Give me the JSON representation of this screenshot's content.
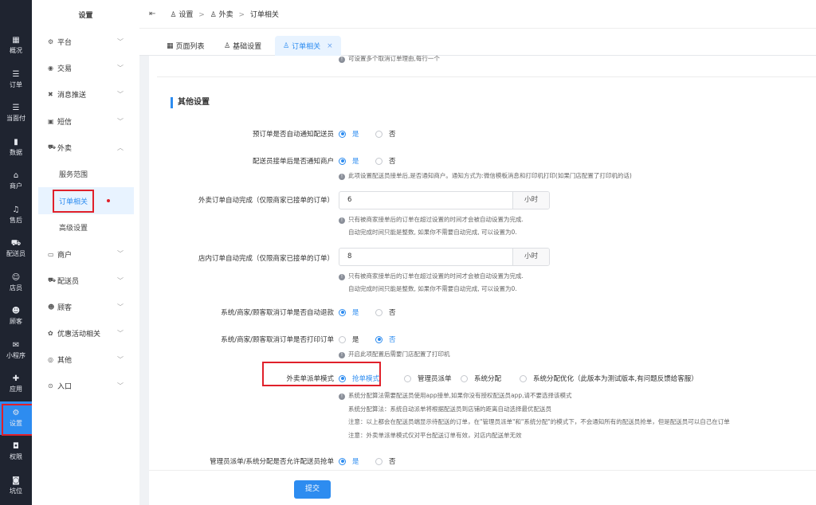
{
  "rail": [
    {
      "icon": "grid-icon",
      "glyph": "▦",
      "label": "概况"
    },
    {
      "icon": "list-icon",
      "glyph": "☰",
      "label": "订单"
    },
    {
      "icon": "list-icon",
      "glyph": "☰",
      "label": "当面付"
    },
    {
      "icon": "bar-chart-icon",
      "glyph": "▮",
      "label": "数据"
    },
    {
      "icon": "store-icon",
      "glyph": "⌂",
      "label": "商户"
    },
    {
      "icon": "headset-icon",
      "glyph": "♫",
      "label": "售后"
    },
    {
      "icon": "delivery-icon",
      "glyph": "⛟",
      "label": "配送员"
    },
    {
      "icon": "user-icon",
      "glyph": "☺",
      "label": "店员"
    },
    {
      "icon": "customer-icon",
      "glyph": "☻",
      "label": "顾客"
    },
    {
      "icon": "chat-icon",
      "glyph": "✉",
      "label": "小程序"
    },
    {
      "icon": "apps-icon",
      "glyph": "✚",
      "label": "应用"
    },
    {
      "icon": "gear-icon",
      "glyph": "⚙",
      "label": "设置"
    },
    {
      "icon": "lock-icon",
      "glyph": "◘",
      "label": "权限"
    },
    {
      "icon": "bookmark-icon",
      "glyph": "◙",
      "label": "坑位"
    }
  ],
  "sidebar": {
    "title": "设置",
    "items_top": [
      {
        "glyph": "⚙",
        "label": "平台",
        "icon": "gear-icon"
      },
      {
        "glyph": "◉",
        "label": "交易",
        "icon": "trade-icon"
      },
      {
        "glyph": "✖",
        "label": "消息推送",
        "icon": "message-icon"
      },
      {
        "glyph": "▣",
        "label": "短信",
        "icon": "sms-icon"
      },
      {
        "glyph": "⛟",
        "label": "外卖",
        "icon": "takeaway-icon"
      }
    ],
    "subitems": [
      "服务范围",
      "订单相关",
      "高级设置"
    ],
    "items_bottom": [
      {
        "glyph": "▭",
        "label": "商户",
        "icon": "store-icon"
      },
      {
        "glyph": "⛟",
        "label": "配送员",
        "icon": "delivery-icon"
      },
      {
        "glyph": "☻",
        "label": "顾客",
        "icon": "customer-icon"
      },
      {
        "glyph": "✿",
        "label": "优惠活动相关",
        "icon": "promo-icon"
      },
      {
        "glyph": "◎",
        "label": "其他",
        "icon": "other-icon"
      },
      {
        "glyph": "⊙",
        "label": "入口",
        "icon": "entry-icon"
      }
    ]
  },
  "breadcrumb": {
    "collapse": "⇤",
    "part1": "设置",
    "part2": "外卖",
    "part3": "订单相关"
  },
  "tabs": [
    {
      "label": "页面列表"
    },
    {
      "label": "基础设置"
    },
    {
      "label": "订单相关",
      "close": "×"
    }
  ],
  "form": {
    "top_help": "可设置多个取消订单理由,每行一个",
    "section_title": "其他设置",
    "yes": "是",
    "no": "否",
    "pre_order_label": "预订单是否自动通知配送员",
    "rider_accept_label": "配送员接单后是否通知商户",
    "rider_accept_help": "此项设置配送员接单后,是否通知商户。通知方式为:微信模板消息和打印机打印(如果门店配置了打印机的话)",
    "takeaway_auto_label": "外卖订单自动完成（仅限商家已接单的订单）",
    "takeaway_auto_value": "6",
    "unit": "小时",
    "auto_help1": "只有被商家接单后的订单在超过设置的时间才会被自动设置为完成.",
    "auto_help2": "自动完成时间只能是整数, 如果你不需要自动完成, 可以设置为0.",
    "instore_auto_label": "店内订单自动完成（仅限商家已接单的订单）",
    "instore_auto_value": "8",
    "refund_label": "系统/商家/顾客取消订单是否自动退款",
    "print_label": "系统/商家/顾客取消订单是否打印订单",
    "print_help": "开启此项配置后需要门店配置了打印机",
    "dispatch_label": "外卖单派单模式",
    "dispatch_options": [
      "抢单模式",
      "管理员派单",
      "系统分配",
      "系统分配优化（此版本为测试版本,有问题反馈给客服）"
    ],
    "dispatch_help1": "系统分配算法需要配送员使用app接单,如果你没有授权配送员app,请不要选择该模式",
    "dispatch_help2": "系统分配算法：系统自动派单将根据配送员到店铺的距离自动选择最优配送员",
    "dispatch_help3": "注意：以上都会在配送员端显示待配送的订单，在\"管理员派单\"和\"系统分配\"的模式下，不会通知所有的配送员抢单，但是配送员可以自己在订单",
    "dispatch_help4": "注意：外卖单派单模式仅对平台配送订单有效，对店内配送单无效",
    "allow_grab_label": "管理员派单/系统分配是否允许配送员抢单"
  },
  "submit": "提交",
  "colors": {
    "accent": "#2d8cf0",
    "rail": "#1f2430",
    "highlight": "#e0202a"
  }
}
